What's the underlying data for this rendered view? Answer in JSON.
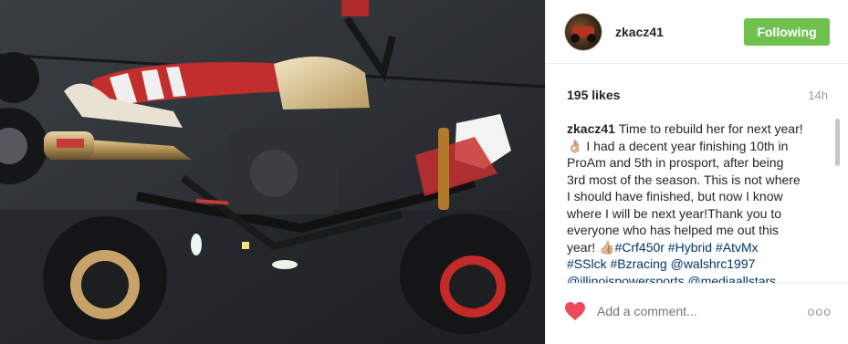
{
  "post": {
    "username": "zkacz41",
    "follow_label": "Following",
    "likes": "195 likes",
    "time": "14h",
    "caption_user": "zkacz41",
    "caption_lines": [
      "Time to rebuild her for next year!",
      "👌🏼 I had a decent year finishing 10th in",
      "ProAm and 5th in prosport, after being",
      "3rd most of the season. This is not where",
      "I should have finished, but now I know",
      "where I will be next year!Thank you to",
      "everyone who has helped me out this",
      "year! 👍🏼"
    ],
    "tags_line1": "#Crf450r #Hybrid #AtvMx",
    "tags_line2": "#SSlck #Bzracing @walshrc1997",
    "tags_line3": "@illinoispowersports @mediaallstars",
    "comment_placeholder": "Add a comment...",
    "more_label": "ooo"
  },
  "colors": {
    "follow": "#70c050",
    "heart": "#ed4956",
    "link": "#003569"
  },
  "icons": {
    "heart": "heart-icon",
    "more": "more-options-icon"
  }
}
